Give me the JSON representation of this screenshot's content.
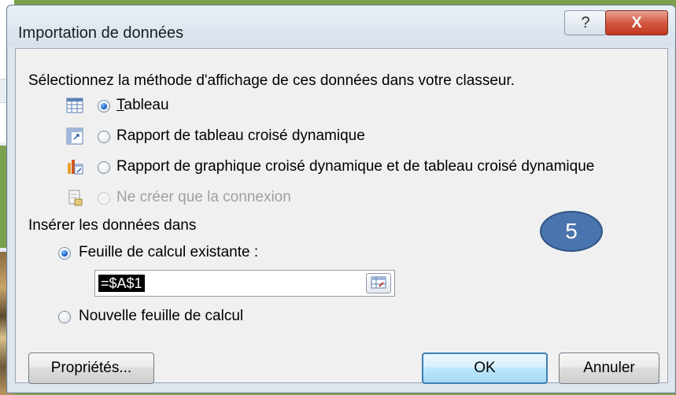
{
  "dialog": {
    "title": "Importation de données",
    "help_label": "?",
    "close_label": "X"
  },
  "view": {
    "instruction": "Sélectionnez la méthode d'affichage de ces données dans votre classeur.",
    "options": [
      {
        "label": "Tableau",
        "selected": true,
        "enabled": true,
        "icon": "table-icon"
      },
      {
        "label": "Rapport de tableau croisé dynamique",
        "selected": false,
        "enabled": true,
        "icon": "pivot-table-icon"
      },
      {
        "label": "Rapport de graphique croisé dynamique et de tableau croisé dynamique",
        "selected": false,
        "enabled": true,
        "icon": "pivot-chart-icon"
      },
      {
        "label": "Ne créer que la connexion",
        "selected": false,
        "enabled": false,
        "icon": "connection-icon"
      }
    ]
  },
  "destination": {
    "heading": "Insérer les données dans",
    "existing_label": "Feuille de calcul existante :",
    "existing_selected": true,
    "reference_value": "=$A$1",
    "new_label": "Nouvelle feuille de calcul",
    "new_selected": false
  },
  "buttons": {
    "properties": "Propriétés...",
    "ok": "OK",
    "cancel": "Annuler"
  },
  "badge": {
    "number": "5",
    "color": "#4a74ad"
  }
}
